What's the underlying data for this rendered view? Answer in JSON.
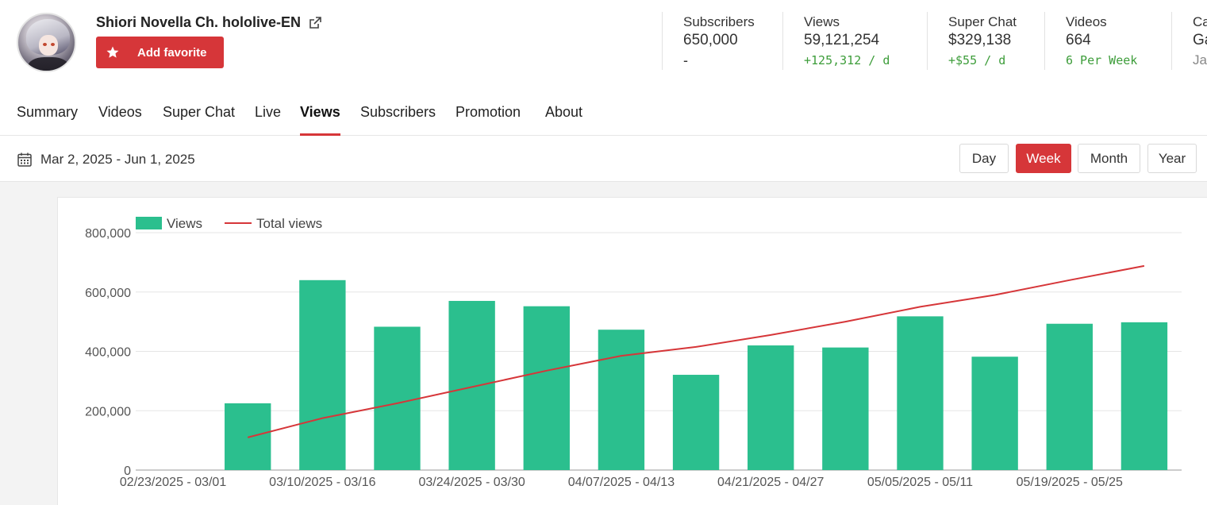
{
  "channel": {
    "name": "Shiori Novella Ch. hololive-EN",
    "favorite_label": "Add favorite"
  },
  "stats": [
    {
      "label": "Subscribers",
      "value": "650,000",
      "delta": "-"
    },
    {
      "label": "Views",
      "value": "59,121,254",
      "delta": "+125,312 / d"
    },
    {
      "label": "Super Chat",
      "value": "$329,138",
      "delta": "+$55 / d"
    },
    {
      "label": "Videos",
      "value": "664",
      "delta": "6 Per Week"
    },
    {
      "label": "Ca",
      "value": "Ga",
      "delta": "Jap"
    }
  ],
  "tabs": [
    "Summary",
    "Videos",
    "Super Chat",
    "Live",
    "Views",
    "Subscribers",
    "Promotion",
    "About"
  ],
  "active_tab": "Views",
  "date_range": "Mar 2, 2025 - Jun 1, 2025",
  "periods": [
    "Day",
    "Week",
    "Month",
    "Year"
  ],
  "active_period": "Week",
  "colors": {
    "accent": "#d63639",
    "bar": "#2bbf8e",
    "line": "#d63639",
    "delta_green": "#3d9d3a"
  },
  "chart_data": {
    "type": "bar",
    "legend": [
      "Views",
      "Total views"
    ],
    "legend_position": "top-left",
    "grid": true,
    "ylim": [
      0,
      800000
    ],
    "yticks": [
      "0",
      "200,000",
      "400,000",
      "600,000",
      "800,000"
    ],
    "xtick_labels": [
      "02/23/2025 - 03/01",
      "03/10/2025 - 03/16",
      "03/24/2025 - 03/30",
      "04/07/2025 - 04/13",
      "04/21/2025 - 04/27",
      "05/05/2025 - 05/11",
      "05/19/2025 - 05/25"
    ],
    "categories": [
      "02/23/2025 - 03/01",
      "03/02/2025 - 03/08",
      "03/10/2025 - 03/16",
      "03/17/2025 - 03/23",
      "03/24/2025 - 03/30",
      "03/31/2025 - 04/06",
      "04/07/2025 - 04/13",
      "04/14/2025 - 04/20",
      "04/21/2025 - 04/27",
      "04/28/2025 - 05/04",
      "05/05/2025 - 05/11",
      "05/12/2025 - 05/18",
      "05/19/2025 - 05/25",
      "05/26/2025 - 06/01"
    ],
    "series": [
      {
        "name": "Views",
        "type": "bar",
        "values": [
          0,
          225000,
          640000,
          483000,
          570000,
          552000,
          473000,
          321000,
          420000,
          413000,
          518000,
          382000,
          493000,
          498000
        ]
      },
      {
        "name": "Total views",
        "type": "line",
        "values": [
          null,
          110000,
          175000,
          225000,
          280000,
          335000,
          385000,
          415000,
          455000,
          500000,
          550000,
          590000,
          640000,
          688000
        ]
      }
    ]
  }
}
